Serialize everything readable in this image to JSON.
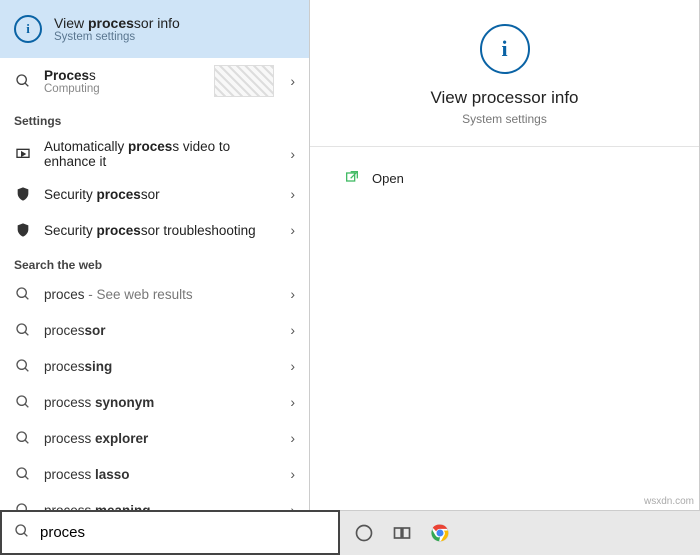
{
  "best_match": {
    "title_pre": "View ",
    "title_bold": "proces",
    "title_post": "sor info",
    "subtitle": "System settings"
  },
  "second_match": {
    "title_pre": "",
    "title_bold": "Proces",
    "title_post": "s",
    "subtitle": "Computing"
  },
  "sections": {
    "settings": "Settings",
    "web": "Search the web"
  },
  "settings_items": [
    {
      "line1_pre": "Automatically ",
      "line1_bold": "proces",
      "line1_post": "s video to",
      "line2": "enhance it"
    },
    {
      "line1_pre": "Security ",
      "line1_bold": "proces",
      "line1_post": "sor",
      "line2": ""
    },
    {
      "line1_pre": "Security ",
      "line1_bold": "proces",
      "line1_post": "sor troubleshooting",
      "line2": ""
    }
  ],
  "web_items": [
    {
      "pre": "proces",
      "bold": "",
      "tail": " - See web results",
      "tail_grey": true
    },
    {
      "pre": "proces",
      "bold": "sor",
      "tail": "",
      "tail_grey": false
    },
    {
      "pre": "proces",
      "bold": "sing",
      "tail": "",
      "tail_grey": false
    },
    {
      "pre": "process ",
      "bold": "synonym",
      "tail": "",
      "tail_grey": false
    },
    {
      "pre": "process ",
      "bold": "explorer",
      "tail": "",
      "tail_grey": false
    },
    {
      "pre": "process ",
      "bold": "lasso",
      "tail": "",
      "tail_grey": false
    },
    {
      "pre": "process ",
      "bold": "meaning",
      "tail": "",
      "tail_grey": false
    }
  ],
  "search_value": "proces",
  "detail": {
    "title": "View processor info",
    "subtitle": "System settings",
    "action_open": "Open"
  },
  "watermark": "wsxdn.com"
}
